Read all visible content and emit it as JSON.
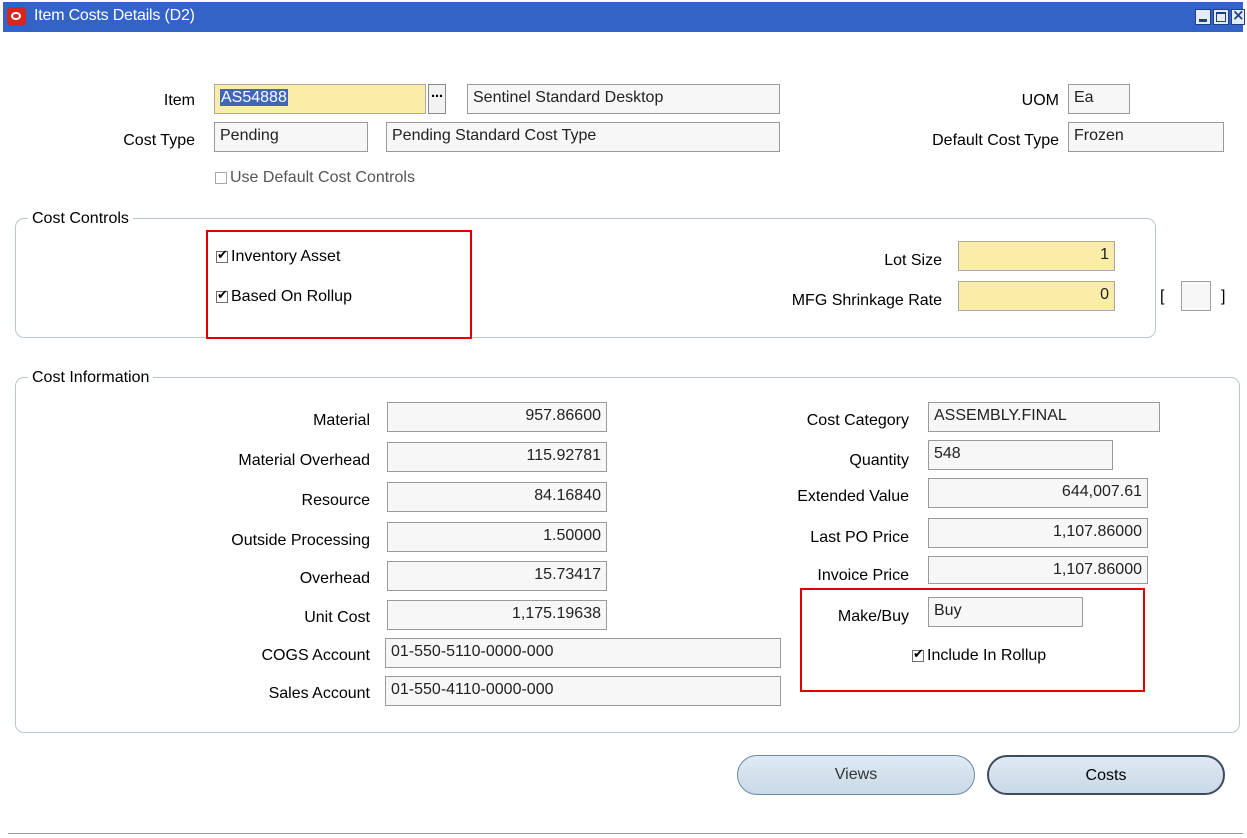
{
  "window": {
    "title": "Item Costs Details (D2)",
    "controls": [
      "minimize-icon",
      "maximize-icon",
      "close-icon"
    ]
  },
  "header": {
    "item_label": "Item",
    "item_value": "AS54888",
    "item_description": "Sentinel Standard Desktop",
    "uom_label": "UOM",
    "uom_value": "Ea",
    "cost_type_label": "Cost Type",
    "cost_type_value": "Pending",
    "cost_type_description": "Pending Standard Cost Type",
    "default_cost_type_label": "Default Cost Type",
    "default_cost_type_value": "Frozen",
    "use_default_label": "Use Default Cost Controls",
    "use_default_checked": false
  },
  "cost_controls": {
    "title": "Cost Controls",
    "inventory_asset_label": "Inventory Asset",
    "inventory_asset_checked": true,
    "based_on_rollup_label": "Based On Rollup",
    "based_on_rollup_checked": true,
    "lot_size_label": "Lot Size",
    "lot_size_value": "1",
    "shrinkage_label": "MFG Shrinkage Rate",
    "shrinkage_value": "0",
    "bracket_open": "[",
    "bracket_close": "]"
  },
  "cost_information": {
    "title": "Cost Information",
    "left": [
      {
        "label": "Material",
        "value": "957.86600"
      },
      {
        "label": "Material Overhead",
        "value": "115.92781"
      },
      {
        "label": "Resource",
        "value": "84.16840"
      },
      {
        "label": "Outside Processing",
        "value": "1.50000"
      },
      {
        "label": "Overhead",
        "value": "15.73417"
      },
      {
        "label": "Unit Cost",
        "value": "1,175.19638"
      }
    ],
    "cogs_account_label": "COGS Account",
    "cogs_account_value": "01-550-5110-0000-000",
    "sales_account_label": "Sales Account",
    "sales_account_value": "01-550-4110-0000-000",
    "cost_category_label": "Cost Category",
    "cost_category_value": "ASSEMBLY.FINAL",
    "quantity_label": "Quantity",
    "quantity_value": "548",
    "extended_value_label": "Extended Value",
    "extended_value_value": "644,007.61",
    "last_po_price_label": "Last PO Price",
    "last_po_price_value": "1,107.86000",
    "invoice_price_label": "Invoice Price",
    "invoice_price_value": "1,107.86000",
    "make_buy_label": "Make/Buy",
    "make_buy_value": "Buy",
    "include_in_rollup_label": "Include In Rollup",
    "include_in_rollup_checked": true
  },
  "buttons": {
    "views_label": "Views",
    "costs_label": "Costs"
  },
  "colors": {
    "titlebar": "#3463c8",
    "required_field": "#fbeda8",
    "highlight_box": "#e00000"
  }
}
